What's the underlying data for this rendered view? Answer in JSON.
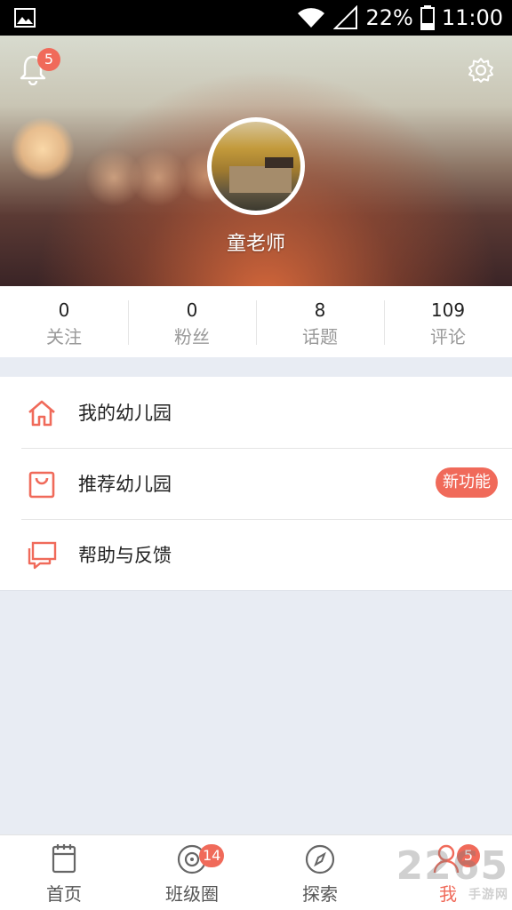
{
  "status_bar": {
    "battery": "22%",
    "time": "11:00",
    "icons": [
      "image-icon",
      "wifi-icon",
      "signal-icon",
      "battery-icon"
    ]
  },
  "header": {
    "notification_count": "5",
    "username": "童老师",
    "icons": [
      "bell-icon",
      "gear-icon"
    ]
  },
  "stats": [
    {
      "value": "0",
      "label": "关注"
    },
    {
      "value": "0",
      "label": "粉丝"
    },
    {
      "value": "8",
      "label": "话题"
    },
    {
      "value": "109",
      "label": "评论"
    }
  ],
  "menu": [
    {
      "label": "我的幼儿园",
      "icon": "home-icon"
    },
    {
      "label": "推荐幼儿园",
      "icon": "bag-icon",
      "badge": "新功能"
    },
    {
      "label": "帮助与反馈",
      "icon": "feedback-icon"
    }
  ],
  "tabbar": [
    {
      "label": "首页",
      "icon": "notebook-icon"
    },
    {
      "label": "班级圈",
      "icon": "circle-icon",
      "badge": "14"
    },
    {
      "label": "探索",
      "icon": "compass-icon"
    },
    {
      "label": "我",
      "icon": "user-icon",
      "badge": "5",
      "active": true
    }
  ],
  "watermark": {
    "text": "2265",
    "sub": "手游网"
  },
  "colors": {
    "accent": "#f06a5a",
    "background": "#e8ecf3"
  }
}
